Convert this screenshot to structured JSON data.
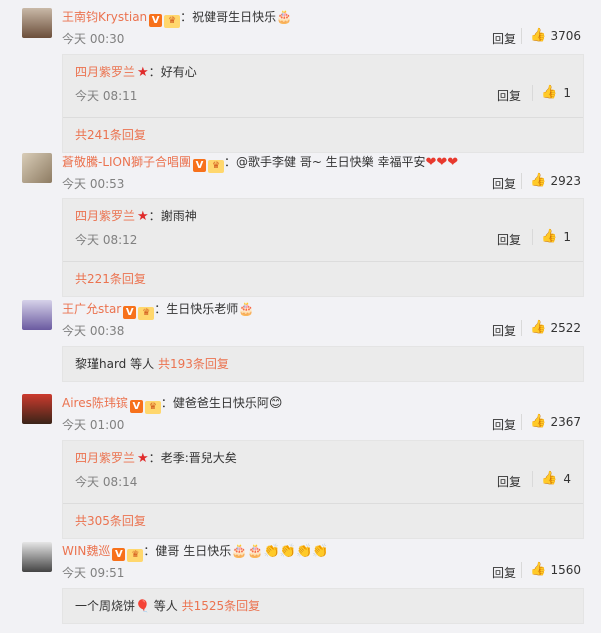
{
  "comments": [
    {
      "user": "王南钧Krystian",
      "text": "祝健哥生日快乐",
      "emoji": "🎂",
      "time": "今天 00:30",
      "reply_label": "回复",
      "likes": "3706",
      "sub": {
        "user": "四月紫罗兰",
        "text": "好有心",
        "time": "今天 08:11",
        "reply_label": "回复",
        "likes": "1"
      },
      "more": "共241条回复"
    },
    {
      "user": "蒼敬騰-LION獅子合唱團",
      "text": "@歌手李健  哥~ 生日快樂 幸福平安",
      "emoji": "❤❤❤",
      "time": "今天 00:53",
      "reply_label": "回复",
      "likes": "2923",
      "sub": {
        "user": "四月紫罗兰",
        "text": "謝雨神",
        "time": "今天 08:12",
        "reply_label": "回复",
        "likes": "1"
      },
      "more": "共221条回复"
    },
    {
      "user": "王广允star",
      "text": "生日快乐老师",
      "emoji": "🎂",
      "time": "今天 00:38",
      "reply_label": "回复",
      "likes": "2522",
      "more_prefix": "黎瑾hard 等人",
      "more": "共193条回复"
    },
    {
      "user": "Aires陈玮镔",
      "text": "健爸爸生日快乐阿",
      "emoji": "😊",
      "time": "今天 01:00",
      "reply_label": "回复",
      "likes": "2367",
      "sub": {
        "user": "四月紫罗兰",
        "text": "老季:晋兒大矣",
        "time": "今天 08:14",
        "reply_label": "回复",
        "likes": "4"
      },
      "more": "共305条回复"
    },
    {
      "user": "WIN魏巡",
      "text": "健哥 生日快乐",
      "emoji": "🎂🎂👏👏👏👏",
      "time": "今天 09:51",
      "reply_label": "回复",
      "likes": "1560",
      "more_prefix": "一个周烧饼🎈 等人",
      "more": "共1525条回复"
    }
  ],
  "icons": {
    "verified": "V",
    "crown": "♛",
    "star": "★",
    "thumb": "👍",
    "colon": "："
  }
}
